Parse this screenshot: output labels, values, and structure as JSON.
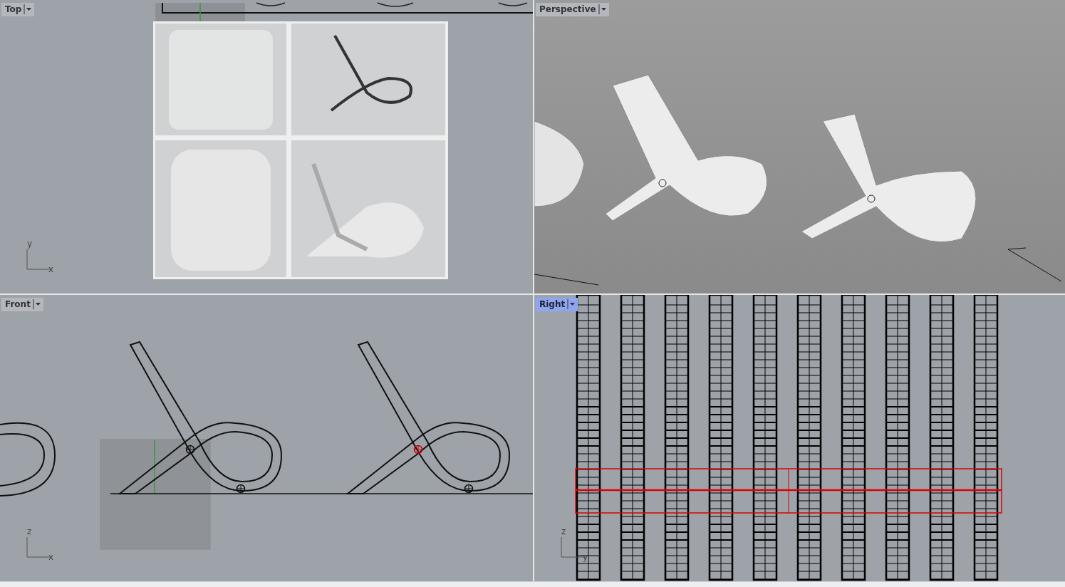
{
  "viewports": [
    {
      "kind": "top",
      "title": "Top",
      "selected": false,
      "axes": {
        "vertical": "y",
        "horizontal": "x"
      }
    },
    {
      "kind": "perspective",
      "title": "Perspective",
      "selected": false
    },
    {
      "kind": "front",
      "title": "Front",
      "selected": false,
      "axes": {
        "vertical": "z",
        "horizontal": "x"
      }
    },
    {
      "kind": "right",
      "title": "Right",
      "selected": true,
      "axes": {
        "vertical": "z",
        "horizontal": "y"
      }
    }
  ]
}
